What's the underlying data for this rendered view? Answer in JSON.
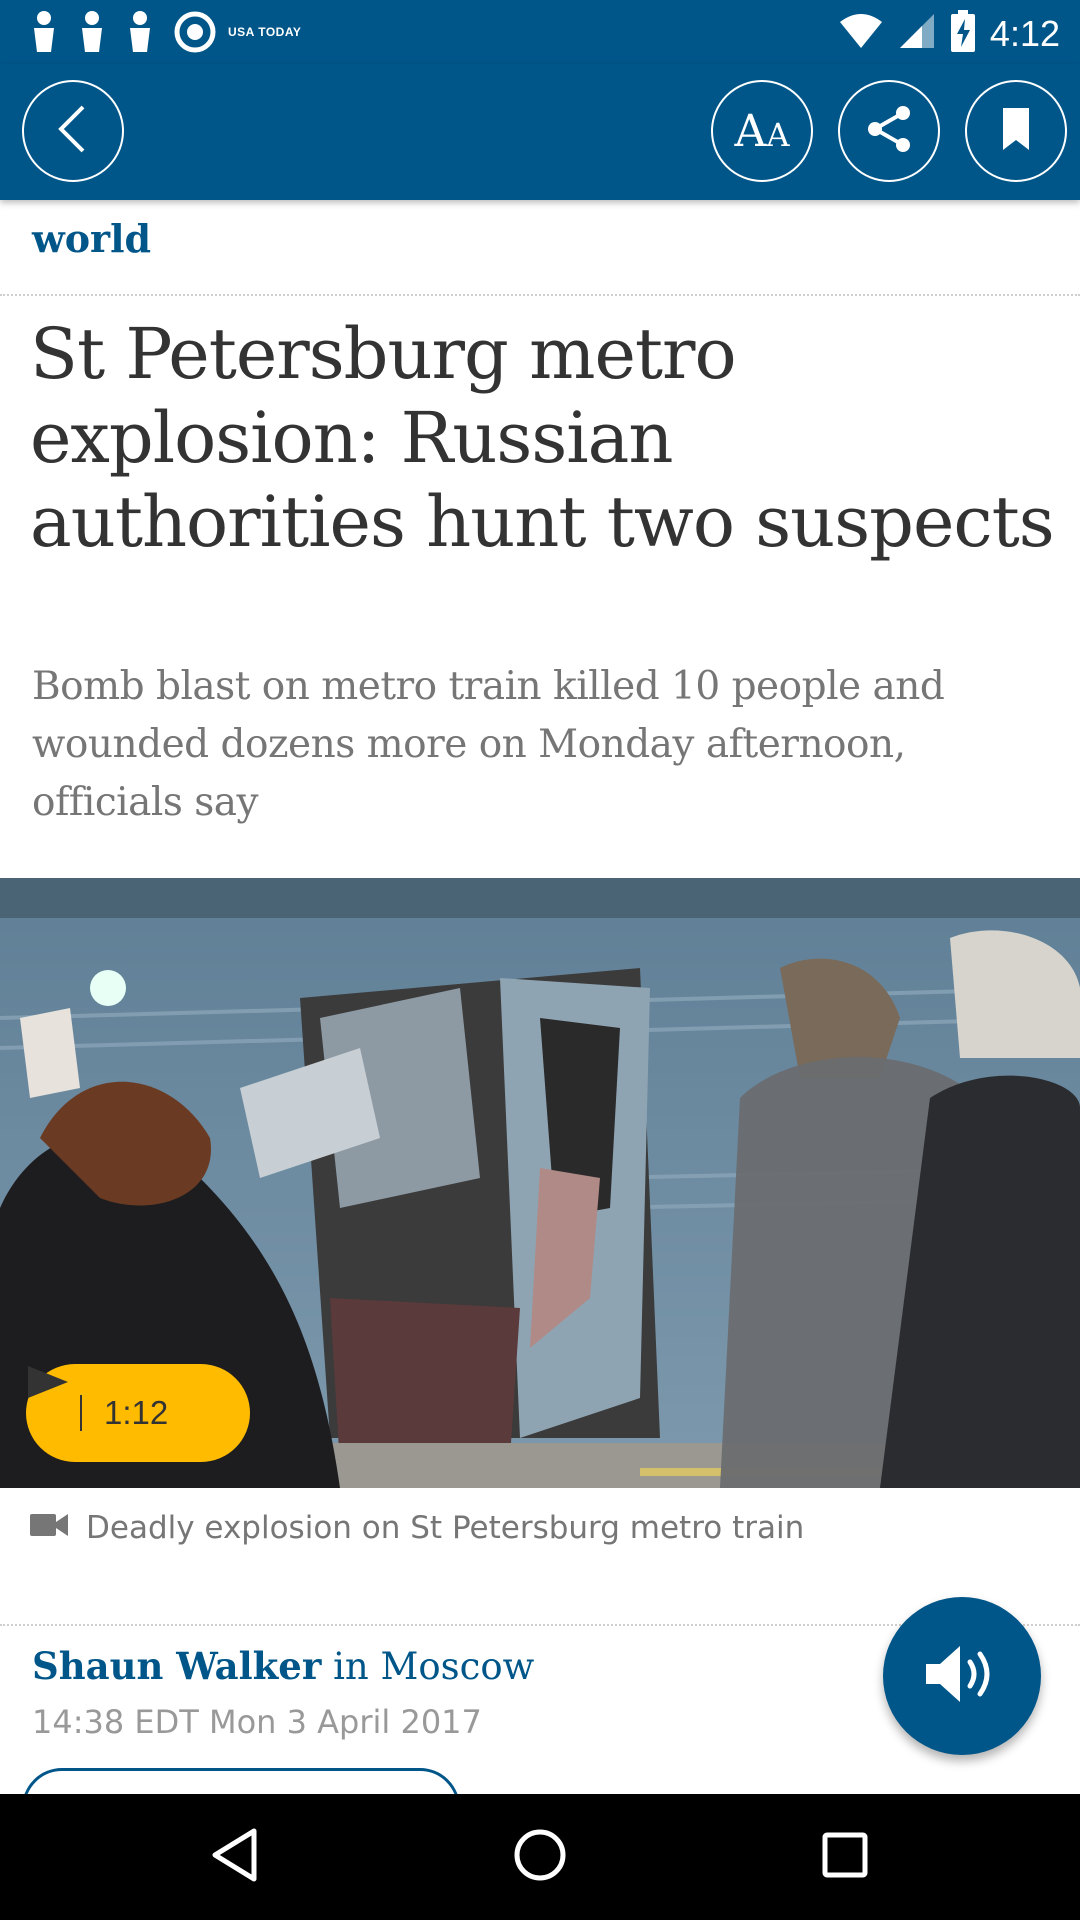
{
  "status_bar": {
    "time": "4:12",
    "notification_icons": [
      "person-pin-icon",
      "person-pin-icon",
      "person-pin-icon",
      "usa-today-icon"
    ],
    "usa_today_label": "USA TODAY",
    "system_icons": [
      "wifi-icon",
      "cell-signal-icon",
      "battery-charging-icon"
    ]
  },
  "header": {
    "back_icon": "chevron-left-icon",
    "text_size_label_big": "A",
    "text_size_label_small": "A",
    "share_icon": "share-icon",
    "bookmark_icon": "bookmark-icon",
    "background_color": "#005689"
  },
  "article": {
    "section": "world",
    "headline": "St Petersburg metro explosion: Russian authorities hunt two suspects",
    "standfirst": "Bomb blast on metro train killed 10 people and wounded dozens more on Monday afternoon, officials say",
    "video": {
      "duration": "1:12",
      "caption": "Deadly explosion on St Petersburg metro train",
      "caption_icon": "video-camera-icon",
      "play_icon": "play-icon"
    },
    "byline": {
      "author": "Shaun Walker",
      "location": " in Moscow"
    },
    "dateline": "14:38 EDT Mon 3 April 2017"
  },
  "listen_button": {
    "icon": "speaker-icon"
  },
  "nav_bar": {
    "icons": [
      "triangle-back-icon",
      "circle-home-icon",
      "square-recents-icon"
    ]
  },
  "colors": {
    "brand_blue": "#005689",
    "play_yellow": "#ffbb00",
    "headline_text": "#333333",
    "standfirst_text": "#767676"
  }
}
